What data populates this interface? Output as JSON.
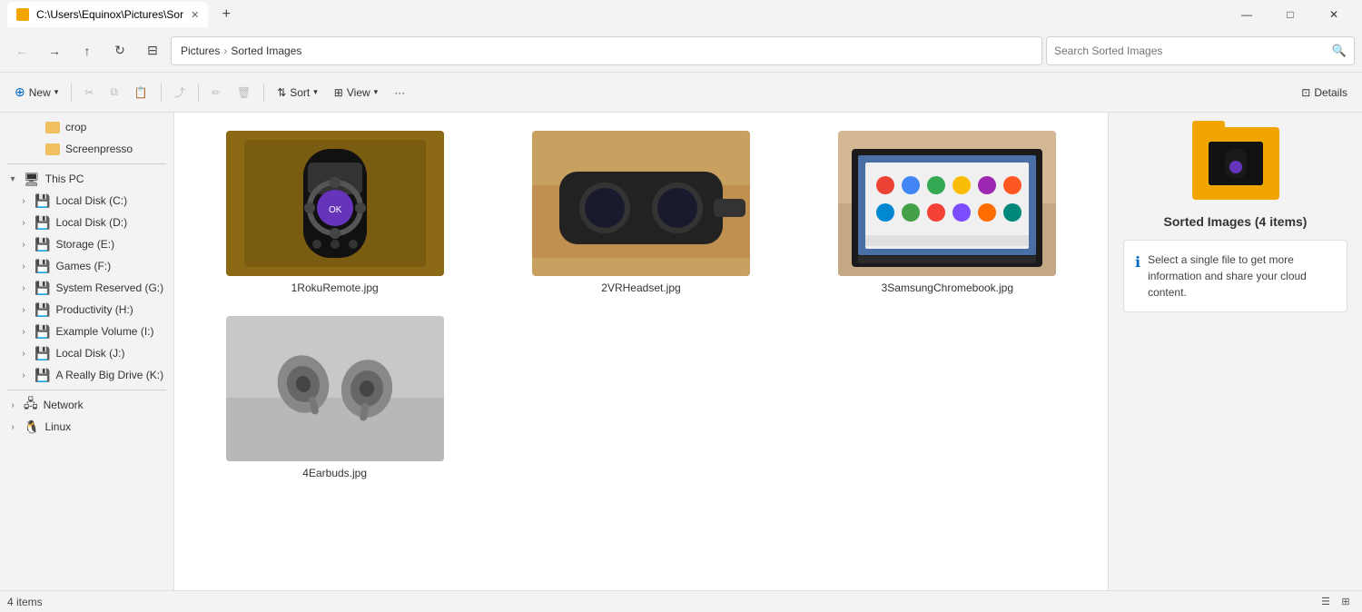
{
  "titlebar": {
    "tab_title": "C:\\Users\\Equinox\\Pictures\\Sor",
    "new_tab_label": "+",
    "minimize": "—",
    "maximize": "□",
    "close": "✕"
  },
  "addressbar": {
    "back": "←",
    "forward": "→",
    "up": "↑",
    "refresh": "↻",
    "breadcrumb": {
      "sep1": "›",
      "item1": "Pictures",
      "sep2": "›",
      "item2": "Sorted Images"
    },
    "search_placeholder": "Search Sorted Images"
  },
  "toolbar": {
    "new_label": "New",
    "cut_icon": "✂",
    "copy_icon": "⧉",
    "paste_icon": "⎗",
    "share_icon": "⤴",
    "rename_icon": "✏",
    "delete_icon": "🗑",
    "sort_label": "Sort",
    "view_label": "View",
    "more_label": "···",
    "details_label": "Details"
  },
  "sidebar": {
    "folders": [
      {
        "name": "crop",
        "indent": 3
      },
      {
        "name": "Screenpresso",
        "indent": 3
      }
    ],
    "thispc": {
      "label": "This PC",
      "drives": [
        {
          "name": "Local Disk (C:)",
          "indent": 2
        },
        {
          "name": "Local Disk (D:)",
          "indent": 2
        },
        {
          "name": "Storage (E:)",
          "indent": 2
        },
        {
          "name": "Games (F:)",
          "indent": 2
        },
        {
          "name": "System Reserved (G:)",
          "indent": 2
        },
        {
          "name": "Productivity (H:)",
          "indent": 2
        },
        {
          "name": "Example Volume (I:)",
          "indent": 2
        },
        {
          "name": "Local Disk (J:)",
          "indent": 2
        },
        {
          "name": "A Really Big Drive (K:)",
          "indent": 2
        }
      ]
    },
    "network": {
      "label": "Network"
    },
    "linux": {
      "label": "Linux"
    }
  },
  "files": [
    {
      "name": "1RokuRemote.jpg",
      "type": "roku"
    },
    {
      "name": "2VRHeadset.jpg",
      "type": "vr"
    },
    {
      "name": "3SamsungChromebook.jpg",
      "type": "chromebook"
    },
    {
      "name": "4Earbuds.jpg",
      "type": "earbuds"
    }
  ],
  "details": {
    "folder_name": "Sorted Images (4 items)",
    "info_text": "Select a single file to get more information and share your cloud content."
  },
  "statusbar": {
    "items_count": "4 items"
  }
}
